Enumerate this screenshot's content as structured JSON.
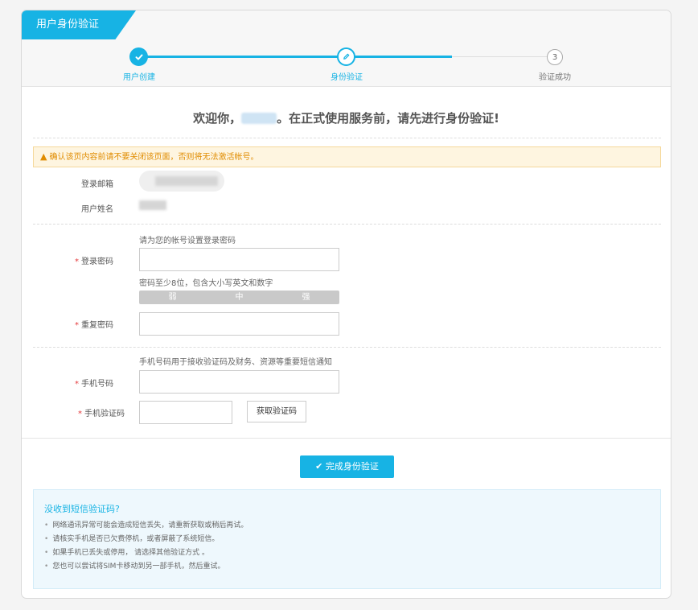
{
  "header": {
    "title": "用户身份验证"
  },
  "steps": [
    {
      "label": "用户创建",
      "state": "done",
      "icon": "check-icon"
    },
    {
      "label": "身份验证",
      "state": "current",
      "icon": "pencil-icon"
    },
    {
      "label": "验证成功",
      "state": "todo",
      "number": "3"
    }
  ],
  "welcome": {
    "prefix": "欢迎你，",
    "suffix": "。在正式使用服务前，请先进行身份验证!"
  },
  "warning": {
    "text": "确认该页内容前请不要关闭该页面，否则将无法激活帐号。",
    "icon": "warning-icon"
  },
  "account": {
    "email_label": "登录邮箱",
    "name_label": "用户姓名"
  },
  "password_section": {
    "hint": "请为您的帐号设置登录密码",
    "password_label": "登录密码",
    "password_rule": "密码至少8位，包含大小写英文和数字",
    "strength": [
      "弱",
      "中",
      "强"
    ],
    "confirm_label": "重复密码"
  },
  "phone_section": {
    "hint": "手机号码用于接收验证码及财务、资源等重要短信通知",
    "phone_label": "手机号码",
    "code_label": "手机验证码",
    "get_code_button": "获取验证码"
  },
  "submit": {
    "label": "完成身份验证",
    "icon": "check-icon"
  },
  "help": {
    "title": "没收到短信验证码?",
    "items": [
      "网络通讯异常可能会造成短信丢失，请重新获取或稍后再试。",
      "请核实手机是否已欠费停机，或者屏蔽了系统短信。",
      "如果手机已丢失或停用， 请选择其他验证方式 。",
      "您也可以尝试将SIM卡移动到另一部手机，然后重试。"
    ]
  },
  "colors": {
    "accent": "#17b3e4",
    "warning": "#e08c00",
    "required": "#e4393c"
  }
}
